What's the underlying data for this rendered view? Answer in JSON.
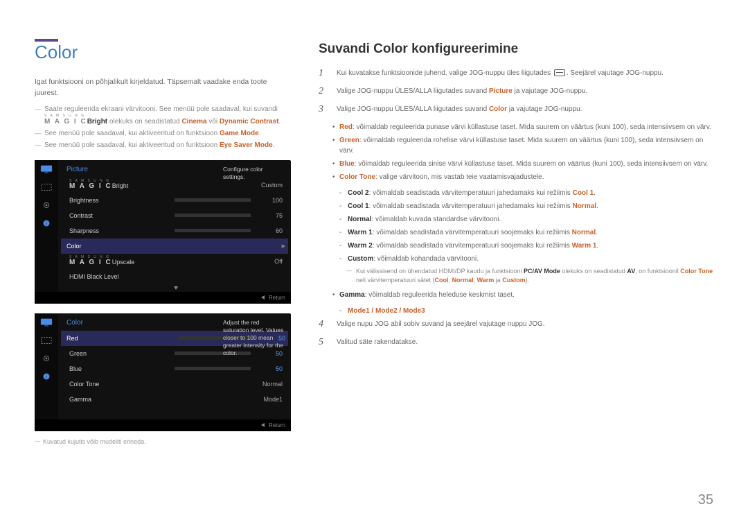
{
  "left": {
    "title": "Color",
    "intro": "Igat funktsiooni on põhjalikult kirjeldatud. Täpsemalt vaadake enda toote juurest.",
    "notes": [
      {
        "pre": "Saate reguleerida ekraani värvitooni. See menüü pole saadaval, kui suvandi ",
        "brand_label": "Bright",
        "post": " olekuks on seadistatud ",
        "hl1": "Cinema",
        "mid": " või ",
        "hl2": "Dynamic Contrast",
        "end": "."
      },
      {
        "text_pre": "See menüü pole saadaval, kui aktiveeritud on funktsioon ",
        "hl": "Game Mode",
        "end": "."
      },
      {
        "text_pre": "See menüü pole saadaval, kui aktiveeritud on funktsioon ",
        "hl": "Eye Saver Mode",
        "end": "."
      }
    ],
    "osd1": {
      "title": "Picture",
      "hint": "Configure color settings.",
      "rows": [
        {
          "label": "Bright",
          "val": "Custom",
          "branded": true
        },
        {
          "label": "Brightness",
          "val": "100",
          "bar": 100
        },
        {
          "label": "Contrast",
          "val": "75",
          "bar": 75
        },
        {
          "label": "Sharpness",
          "val": "60",
          "bar": 60
        },
        {
          "label": "Color",
          "selected": true
        },
        {
          "label": "Upscale",
          "val": "Off",
          "branded": true
        },
        {
          "label": "HDMI Black Level",
          "dim": true
        }
      ],
      "return": "Return"
    },
    "osd2": {
      "title": "Color",
      "hint": "Adjust the red saturation level. Values closer to 100 mean greater intensity for the color.",
      "rows": [
        {
          "label": "Red",
          "val": "50",
          "bar": 50,
          "cls": "red",
          "selected": true,
          "blueval": true
        },
        {
          "label": "Green",
          "val": "50",
          "bar": 50,
          "cls": "green",
          "blueval": true
        },
        {
          "label": "Blue",
          "val": "50",
          "bar": 50,
          "cls": "blue",
          "blueval": true
        },
        {
          "label": "Color Tone",
          "val": "Normal"
        },
        {
          "label": "Gamma",
          "val": "Mode1"
        }
      ],
      "return": "Return"
    },
    "bottomnote": "Kuvatud kujutis võib mudeliti erineda."
  },
  "right": {
    "title": "Suvandi Color konfigureerimine",
    "steps": [
      {
        "n": "1",
        "pre": "Kui kuvatakse funktsioonide juhend, valige JOG-nuppu üles liigutades ",
        "icon": true,
        "post": ". Seejärel vajutage JOG-nuppu."
      },
      {
        "n": "2",
        "pre": "Valige JOG-nuppu ÜLES/ALLA liigutades suvand ",
        "hl": "Picture",
        "post": " ja vajutage JOG-nuppu."
      },
      {
        "n": "3",
        "pre": "Valige JOG-nuppu ÜLES/ALLA liigutades suvand ",
        "hl": "Color",
        "post": " ja vajutage JOG-nuppu."
      }
    ],
    "bullets": [
      {
        "hl": "Red",
        "text": ": võimaldab reguleerida punase värvi küllastuse taset. Mida suurem on väärtus (kuni 100), seda intensiivsem on värv."
      },
      {
        "hl": "Green",
        "text": ": võimaldab reguleerida rohelise värvi küllastuse taset. Mida suurem on väärtus (kuni 100), seda intensiivsem on värv."
      },
      {
        "hl": "Blue",
        "text": ": võimaldab reguleerida sinise värvi küllastuse taset. Mida suurem on väärtus (kuni 100), seda intensiivsem on värv."
      },
      {
        "hl": "Color Tone",
        "text": ": valige värvitoon, mis vastab teie vaatamisvajadustele."
      }
    ],
    "colortone": [
      {
        "hl": "Cool 2",
        "text": ": võimaldab seadistada värvitemperatuuri jahedamaks kui režiimis ",
        "hl2": "Cool 1",
        "end": "."
      },
      {
        "hl": "Cool 1",
        "text": ": võimaldab seadistada värvitemperatuuri jahedamaks kui režiimis ",
        "hl2": "Normal",
        "end": "."
      },
      {
        "hl": "Normal",
        "text": ": võimaldab kuvada standardse värvitooni.",
        "hl2": "",
        "end": ""
      },
      {
        "hl": "Warm 1",
        "text": ": võimaldab seadistada värvitemperatuuri soojemaks kui režiimis ",
        "hl2": "Normal",
        "end": "."
      },
      {
        "hl": "Warm 2",
        "text": ": võimaldab seadistada värvitemperatuuri soojemaks kui režiimis ",
        "hl2": "Warm 1",
        "end": "."
      },
      {
        "hl": "Custom",
        "text": ": võimaldab kohandada värvitooni.",
        "hl2": "",
        "end": ""
      }
    ],
    "subnote": {
      "pre": "Kui välissisend on ühendatud HDMI/DP kaudu ja funktsiooni ",
      "b1": "PC/AV Mode",
      "mid1": " olekuks on seadistatud ",
      "b2": "AV",
      "mid2": ", on funktsioonil ",
      "b3": "Color Tone",
      "mid3": " neli värvitemperatuuri sätet (",
      "h1": "Cool",
      "c1": ", ",
      "h2": "Normal",
      "c2": ", ",
      "h3": "Warm",
      "c3": " ja ",
      "h4": "Custom",
      "end": ")."
    },
    "gamma": {
      "hl": "Gamma",
      "text": ": võimaldab reguleerida heleduse keskmist taset."
    },
    "gammamodes": "Mode1 / Mode2 / Mode3",
    "step4": {
      "n": "4",
      "text": "Valige nupu JOG abil sobiv suvand ja seejärel vajutage nuppu JOG."
    },
    "step5": {
      "n": "5",
      "text": "Valitud säte rakendatakse."
    }
  },
  "pagenum": "35",
  "icons": {
    "monitor": "monitor-icon",
    "frame": "frame-icon",
    "gear": "gear-icon",
    "info": "info-icon"
  }
}
